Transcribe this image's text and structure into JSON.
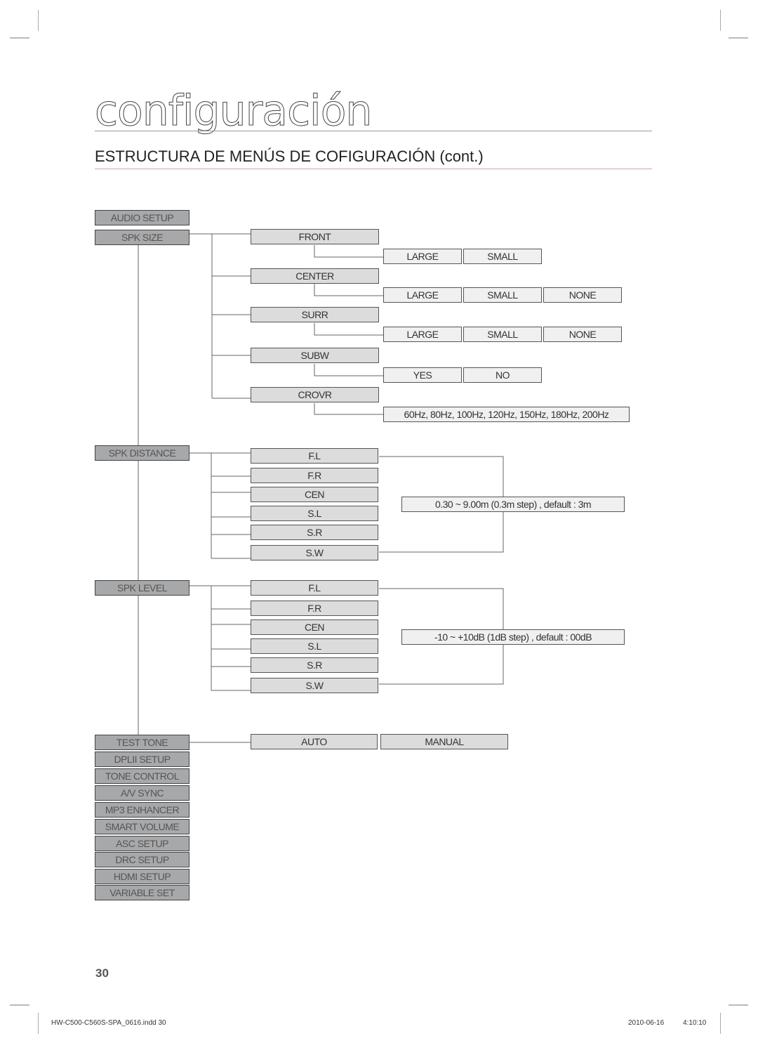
{
  "header": {
    "section_title": "configuración",
    "subtitle": "ESTRUCTURA DE MENÚS DE COFIGURACIÓN (cont.)"
  },
  "menu": {
    "root": "AUDIO SETUP",
    "spk_size": {
      "label": "SPK SIZE",
      "items": [
        {
          "label": "FRONT",
          "options": [
            "LARGE",
            "SMALL"
          ]
        },
        {
          "label": "CENTER",
          "options": [
            "LARGE",
            "SMALL",
            "NONE"
          ]
        },
        {
          "label": "SURR",
          "options": [
            "LARGE",
            "SMALL",
            "NONE"
          ]
        },
        {
          "label": "SUBW",
          "options": [
            "YES",
            "NO"
          ]
        },
        {
          "label": "CROVR",
          "options": [
            "60Hz, 80Hz, 100Hz, 120Hz, 150Hz, 180Hz, 200Hz"
          ]
        }
      ]
    },
    "spk_distance": {
      "label": "SPK DISTANCE",
      "items": [
        "F.L",
        "F.R",
        "CEN",
        "S.L",
        "S.R",
        "S.W"
      ],
      "range": "0.30 ~ 9.00m (0.3m step) , default : 3m"
    },
    "spk_level": {
      "label": "SPK LEVEL",
      "items": [
        "F.L",
        "F.R",
        "CEN",
        "S.L",
        "S.R",
        "S.W"
      ],
      "range": "-10 ~ +10dB (1dB step) , default : 00dB"
    },
    "test_tone": {
      "label": "TEST TONE",
      "options": [
        "AUTO",
        "MANUAL"
      ]
    },
    "other_items": [
      "DPLII SETUP",
      "TONE CONTROL",
      "A/V SYNC",
      "MP3 ENHANCER",
      "SMART VOLUME",
      "ASC SETUP",
      "DRC SETUP",
      "HDMI SETUP",
      "VARIABLE SET"
    ]
  },
  "footer": {
    "page_number": "30",
    "file_info": "HW-C500-C560S-SPA_0616.indd   30",
    "date": "2010-06-16",
    "time": "4:10:10"
  }
}
